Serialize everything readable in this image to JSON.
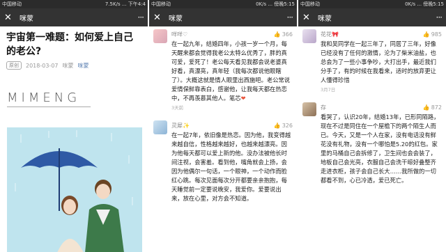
{
  "panels": [
    {
      "status": {
        "carrier": "中国移动",
        "right": "7.5K/s ... 下午4:4"
      },
      "header": {
        "close": "✕",
        "title": "咪蒙",
        "more": "···"
      },
      "article": {
        "title": "宇宙第一难题：如何爱上自己的老公?",
        "original_tag": "原创",
        "date": "2018-03-07",
        "author_label": "咪蒙",
        "author_link": "咪蒙",
        "logo": "MIMENG"
      }
    },
    {
      "status": {
        "carrier": "中国移动",
        "right": "0K/s ... 傍晚5:15"
      },
      "header": {
        "close": "✕",
        "title": "咪蒙",
        "more": "···"
      },
      "comments": [
        {
          "name": "咩咩♡",
          "likes": "366",
          "text": "在一起九年，结婚四年，小孩一岁一个月，每天醒来都会觉得我老公太特么优秀了，胖的真可爱，爱死了！老公每天看见我都会说老婆真好看，真漂亮，真年轻（我每次都说他眼瞎了）。大概这就是情人眼里出西施吧。老公常说爱情保鲜靠表白，感谢他，让我每天都在热恋中，不再羡慕其他人。笔芯",
          "heart": "❤",
          "time": "3天前"
        },
        {
          "name": "灵犀✨",
          "likes": "326",
          "text": "在一起7年，依旧像是热恋。因为他，我变得越来越自信，性格越来越好，也越来越漂亮。因为他每天都可以爱上新的他。没办法被他长时间注视，会害羞。看到他，嘴角就会上扬，会因为他偶尔一句话，一个眼神，一个动作而脸红心跳。每次见面每次分开都要亲亲抱抱，每天睡觉前一定要说晚安，我爱你。爱要说出来，放在心里，对方会不知道。",
          "time": ""
        }
      ]
    },
    {
      "status": {
        "carrier": "中国移动",
        "right": "0K/s ... 傍晚5:15"
      },
      "header": {
        "close": "✕",
        "title": "咪蒙",
        "more": "···"
      },
      "comments": [
        {
          "name": "花花🎀",
          "likes": "985",
          "text": "我和吴同学在一起三年了，同居了三年，好像已经没有了任何的激情，沦为了柴米油盐，也总会为了一些小事争吵，大打出手，最近我们分手了，有的时候在我看来，适时的放弃更让人懂得珍惜",
          "time": "3月7日"
        },
        {
          "name": "存",
          "likes": "872",
          "text": "看哭了，认识20年，结婚13年，已形同陌路，现在不过是同住在一个屋檐下的两个陌生人而已。今天，又是一个人在家，没有电话没有鲜花没有礼物，没有一个哪怕是5.20的红包。家里的马桶自己会拆修了，卫生间也会会装了，地板自己会光亮，衣服自己会洗干晾好叠整齐走进衣柜，孩子会自己长大……我所做的一切都看不到，心已冷透，爱已死亡。",
          "time": ""
        }
      ]
    }
  ],
  "colors": {
    "header_bg": "#333333",
    "status_bg": "#2b2b2b",
    "author": "#5a7fb1",
    "illus_bg": "#bfe4ee"
  }
}
